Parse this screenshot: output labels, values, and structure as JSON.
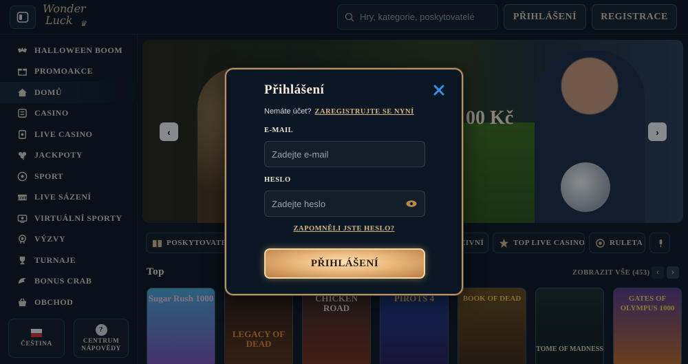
{
  "header": {
    "logo_line1": "Wonder",
    "logo_line2": "Luck",
    "search_placeholder": "Hry, kategorie, poskytovatelé",
    "login_label": "PŘIHLÁŠENÍ",
    "register_label": "REGISTRACE"
  },
  "sidebar": {
    "items": [
      {
        "label": "HALLOWEEN BOOM",
        "icon": "bat-icon"
      },
      {
        "label": "PROMOAKCE",
        "icon": "gift-icon"
      },
      {
        "label": "DOMŮ",
        "icon": "home-icon"
      },
      {
        "label": "CASINO",
        "icon": "casino-icon"
      },
      {
        "label": "LIVE CASINO",
        "icon": "live-casino-icon"
      },
      {
        "label": "JACKPOTY",
        "icon": "clover-icon"
      },
      {
        "label": "SPORT",
        "icon": "soccer-ball-icon"
      },
      {
        "label": "LIVE SÁZENÍ",
        "icon": "live-badge-icon"
      },
      {
        "label": "VIRTUÁLNÍ SPORTY",
        "icon": "virtual-sports-icon"
      },
      {
        "label": "VÝZVY",
        "icon": "challenge-icon"
      },
      {
        "label": "TURNAJE",
        "icon": "trophy-icon"
      },
      {
        "label": "BONUS CRAB",
        "icon": "claw-icon"
      },
      {
        "label": "OBCHOD",
        "icon": "basket-icon"
      }
    ],
    "language_label": "ČEŠTINA",
    "help_line1": "CENTRUM",
    "help_line2": "NÁPOVĚDY"
  },
  "banner": {
    "amount_text": "00 Kč"
  },
  "chips": [
    {
      "label": "POSKYTOVATELÉ",
      "icon": "book-icon"
    },
    {
      "label": "ŽIVNÍ",
      "icon": "none"
    },
    {
      "label": "TOP LIVE CASINO",
      "icon": "star-icon"
    },
    {
      "label": "RULETA",
      "icon": "roulette-icon"
    }
  ],
  "section": {
    "title": "Top",
    "view_all": "ZOBRAZIT VŠE (453)"
  },
  "games": [
    {
      "title": "Sugar Rush 1000",
      "color": "#e6a2c8"
    },
    {
      "title": "LEGACY OF DEAD",
      "color": "#d07a2c"
    },
    {
      "title": "CHICKEN ROAD",
      "color": "#f0e8d8"
    },
    {
      "title": "PIROTS 4",
      "color": "#f2d25a"
    },
    {
      "title": "BOOK OF DEAD",
      "color": "#e6b356"
    },
    {
      "title": "TOME OF MADNESS",
      "color": "#cfd8b0"
    },
    {
      "title": "GATES OF OLYMPUS 1000",
      "color": "#f3cf5a"
    }
  ],
  "modal": {
    "title": "Přihlášení",
    "no_account_text": "Nemáte účet?",
    "register_link": "ZAREGISTRUJTE SE NYNÍ",
    "email_label": "E-MAIL",
    "email_placeholder": "Zadejte e-mail",
    "password_label": "HESLO",
    "password_placeholder": "Zadejte heslo",
    "forgot_link": "ZAPOMNĚLI JSTE HESLO?",
    "submit_label": "PŘIHLÁŠENÍ"
  },
  "colors": {
    "accent_gold": "#d6b480",
    "close_blue": "#3b8ee8"
  }
}
